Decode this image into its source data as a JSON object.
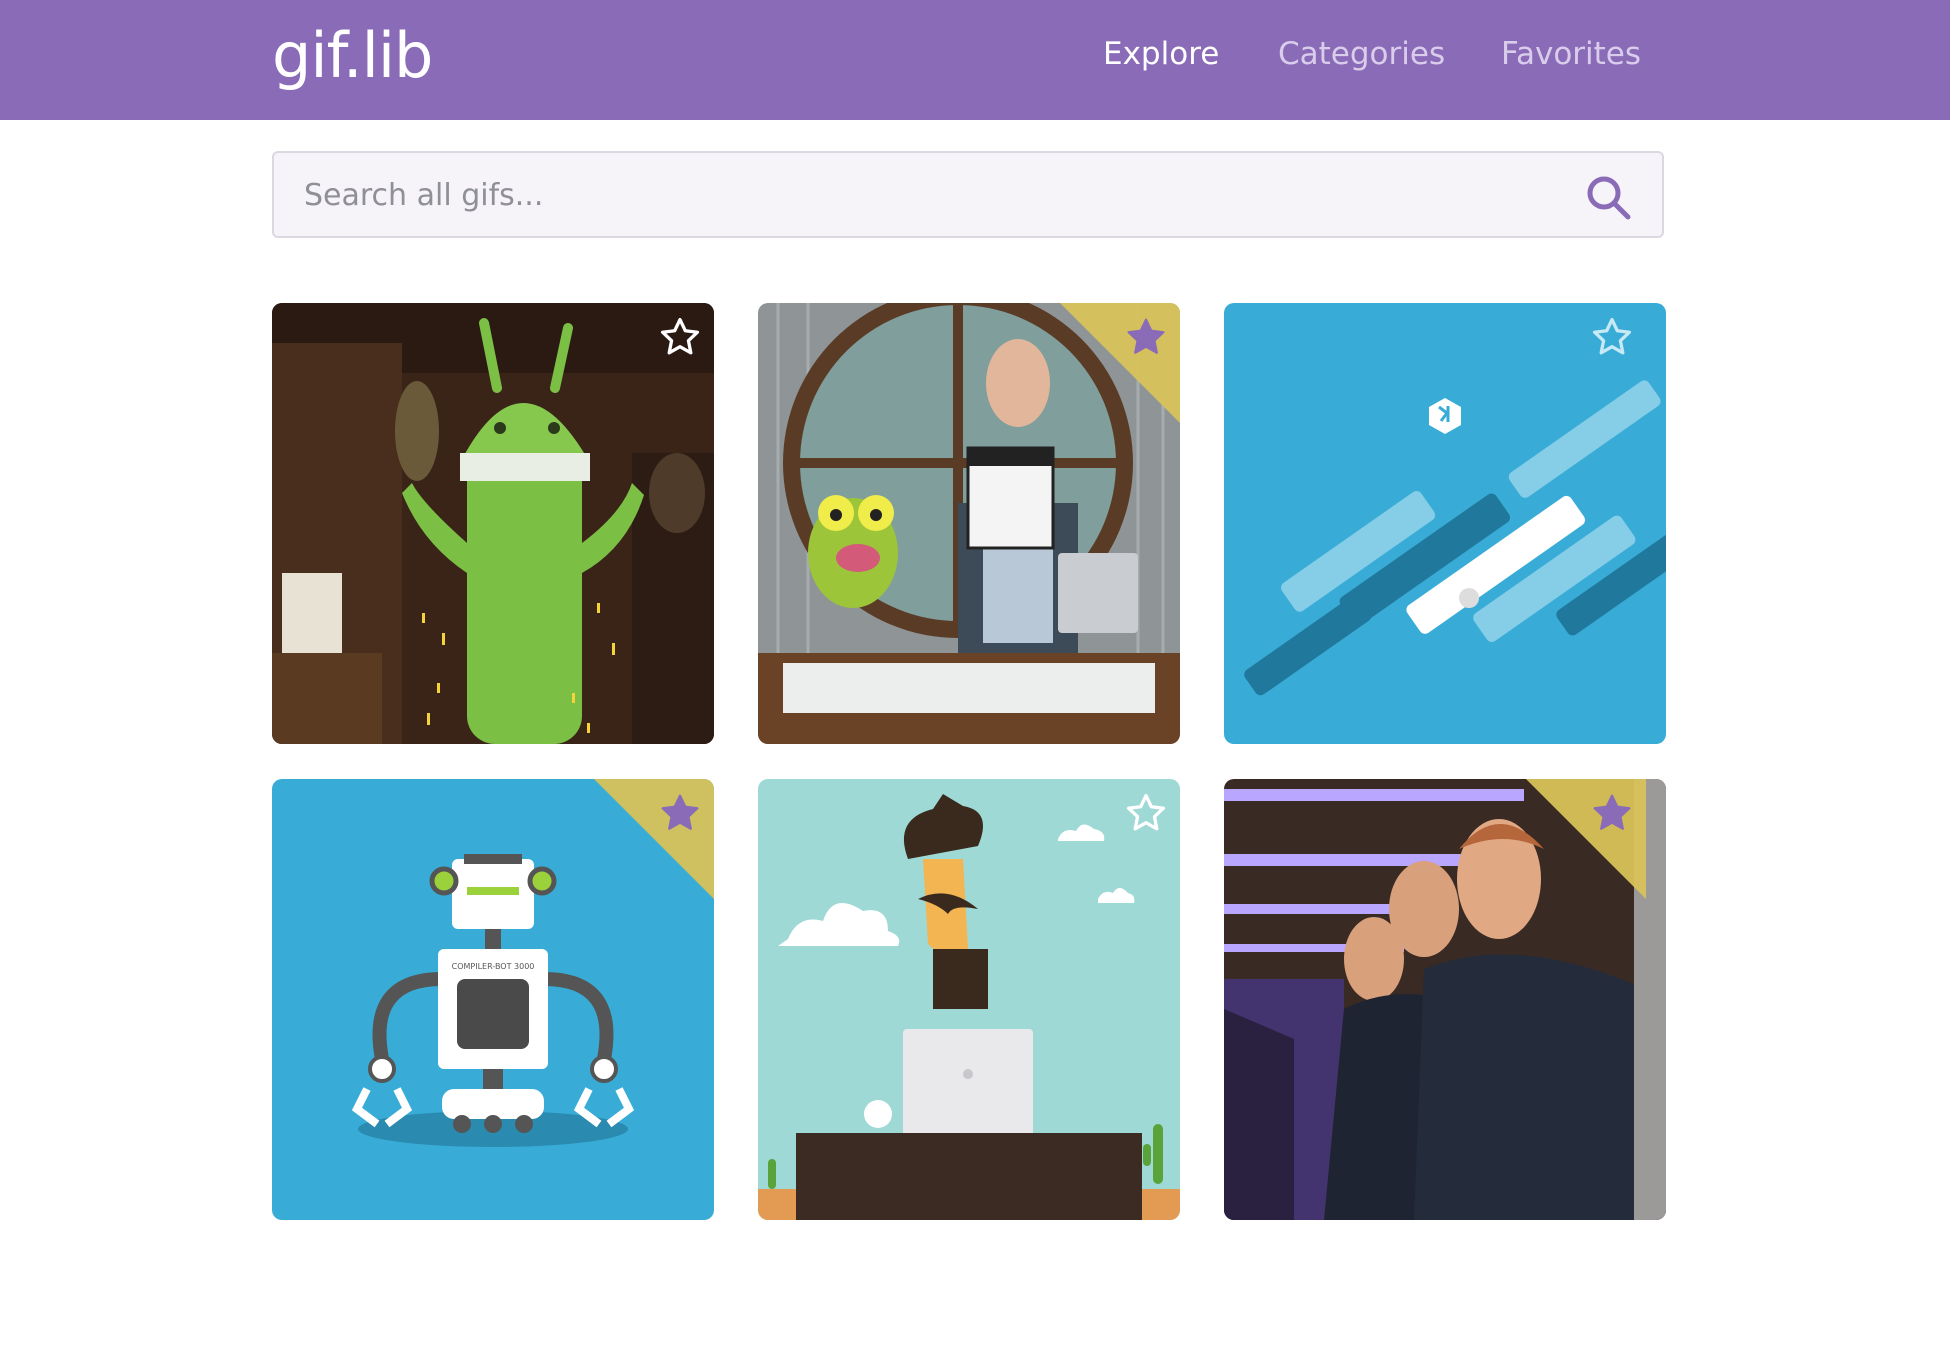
{
  "header": {
    "logo": "gif.lib",
    "nav": [
      {
        "label": "Explore",
        "active": true
      },
      {
        "label": "Categories",
        "active": false
      },
      {
        "label": "Favorites",
        "active": false
      }
    ]
  },
  "search": {
    "placeholder": "Search all gifs...",
    "icon": "search-icon"
  },
  "gallery": {
    "items": [
      {
        "subject": "android-mascot",
        "favorited": false
      },
      {
        "subject": "host-with-frog-puppet",
        "favorited": true
      },
      {
        "subject": "blue-abstract-bars",
        "favorited": false
      },
      {
        "subject": "compiler-robot",
        "favorited": true,
        "caption": "COMPILER-BOT 3000"
      },
      {
        "subject": "cowboy-with-laptop",
        "favorited": false
      },
      {
        "subject": "infinite-mirror-man",
        "favorited": true
      }
    ]
  },
  "colors": {
    "header": "#8a6bb7",
    "accent": "#8a6bb7",
    "favorite_corner": "#d8c25a"
  }
}
